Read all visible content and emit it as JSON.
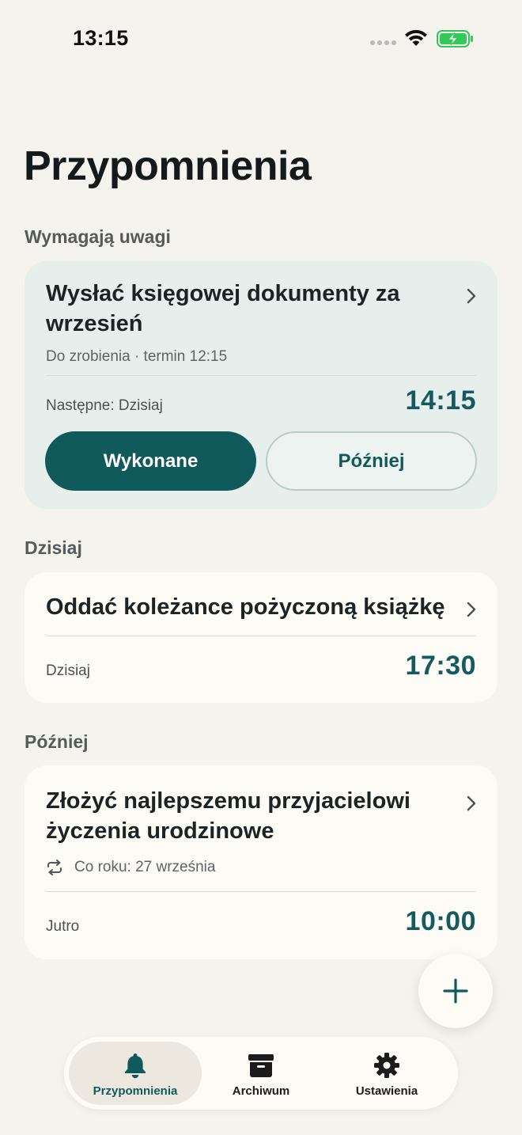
{
  "status_bar": {
    "time": "13:15"
  },
  "page": {
    "title": "Przypomnienia"
  },
  "sections": {
    "attention": "Wymagają uwagi",
    "today": "Dzisiaj",
    "later": "Później"
  },
  "attention_card": {
    "title": "Wysłać księgowej dokumenty za wrzesień",
    "subtitle": "Do zrobienia · termin 12:15",
    "when": "Następne: Dzisiaj",
    "time": "14:15",
    "done_label": "Wykonane",
    "later_label": "Później"
  },
  "today_card": {
    "title": "Oddać koleżance pożyczoną książkę",
    "when": "Dzisiaj",
    "time": "17:30"
  },
  "later_card": {
    "title": "Złożyć najlepszemu przyjacielowi życzenia urodzinowe",
    "repeat": "Co roku: 27 września",
    "when": "Jutro",
    "time": "10:00"
  },
  "tabs": [
    {
      "label": "Przypomnienia",
      "icon": "bell-icon",
      "active": true
    },
    {
      "label": "Archiwum",
      "icon": "archive-icon",
      "active": false
    },
    {
      "label": "Ustawienia",
      "icon": "gear-icon",
      "active": false
    }
  ],
  "colors": {
    "background": "#f5f3ee",
    "accent": "#115a5c",
    "card": "#fdfbf6",
    "attention_card": "#e7efec",
    "battery": "#34c759"
  }
}
